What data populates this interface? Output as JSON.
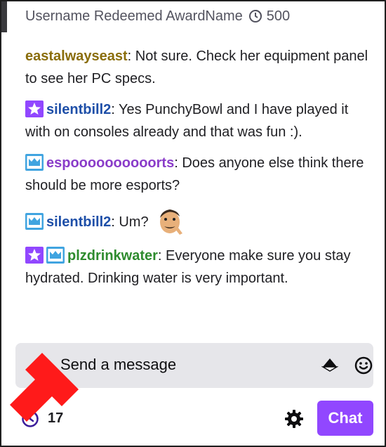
{
  "redemption": {
    "text": "Username Redeemed AwardName",
    "cost": "500"
  },
  "messages": [
    {
      "badges": [],
      "user": "eastalwayseast",
      "user_color": "#8a6d0b",
      "text": ": Not sure. Check her equipment panel to see her PC specs.",
      "emote": false
    },
    {
      "badges": [
        "star-badge-icon"
      ],
      "user": "silentbill2",
      "user_color": "#1e4fa8",
      "text": ": Yes PunchyBowl and I have played it with on consoles already and that was fun :).",
      "emote": false
    },
    {
      "badges": [
        "crown-badge-icon"
      ],
      "user": "espoooooooooorts",
      "user_color": "#8a3cc9",
      "text": ": Does anyone else think there should be more esports?",
      "emote": false
    },
    {
      "badges": [
        "crown-badge-icon"
      ],
      "user": "silentbill2",
      "user_color": "#1e4fa8",
      "text": ": Um?",
      "emote": true
    },
    {
      "badges": [
        "star-badge-icon",
        "crown-badge-icon"
      ],
      "user": "plzdrinkwater",
      "user_color": "#2e8b2e",
      "text": ": Everyone make sure you stay hydrated. Drinking water is very important.",
      "emote": false
    }
  ],
  "input": {
    "placeholder": "Send a message"
  },
  "footer": {
    "points": "17",
    "chat_button": "Chat"
  },
  "colors": {
    "accent": "#9147ff",
    "star_badge": "#9147ff",
    "crown_badge": "#40a4e0",
    "arrow": "#ff1a1a"
  }
}
